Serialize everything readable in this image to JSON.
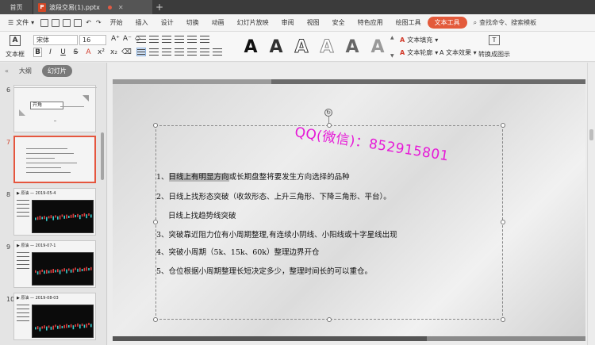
{
  "titlebar": {
    "home_tab": "首页",
    "file_tab": "波段交易(1).pptx",
    "file_icon": "P",
    "add_tab": "+"
  },
  "menubar": {
    "file_menu": "文件",
    "items": [
      "开始",
      "插入",
      "设计",
      "切换",
      "动画",
      "幻灯片放映",
      "审阅",
      "视图",
      "安全",
      "特色应用",
      "绘图工具"
    ],
    "active": "文本工具",
    "search": "查找命令、搜索模板"
  },
  "ribbon": {
    "textbox": "文本框",
    "font_name": "宋体",
    "font_size": "16",
    "text_fill": "文本填充",
    "text_outline": "文本轮廓",
    "text_effect": "文本效果",
    "convert": "转换成图示",
    "style_glyph": "A"
  },
  "leftpanel": {
    "tab_outline": "大纲",
    "tab_slides": "幻灯片",
    "collapse": "«",
    "slides": [
      {
        "num": "6",
        "label": "开角"
      },
      {
        "num": "7",
        "label": ""
      },
      {
        "num": "8",
        "label": "▶ 原油 — 2019-05-4"
      },
      {
        "num": "9",
        "label": "▶ 原油 — 2019-07-1"
      },
      {
        "num": "10",
        "label": "▶ 原油 — 2019-08-03"
      }
    ]
  },
  "slide": {
    "watermark": "QQ(微信)：852915801",
    "lines": [
      "1、日线上有明显方向或长期盘整将要发生方向选择的品种",
      "2、日线上找形态突破（收敛形态、上升三角形、下降三角形、平台）。",
      "日线上找趋势线突破",
      "3、突破靠近阻力位有小周期整理,有连续小阴线、小阳线或十字星线出现",
      "4、突破小周期（5k、15k、60k）整理边界开仓",
      "5、仓位根据小周期整理长短决定多少，整理时间长的可以重仓。"
    ],
    "line1_prefix": "1、",
    "line1_highlight": "日线上有明显方向",
    "line1_rest": "或长期盘整将要发生方向选择的品种"
  }
}
